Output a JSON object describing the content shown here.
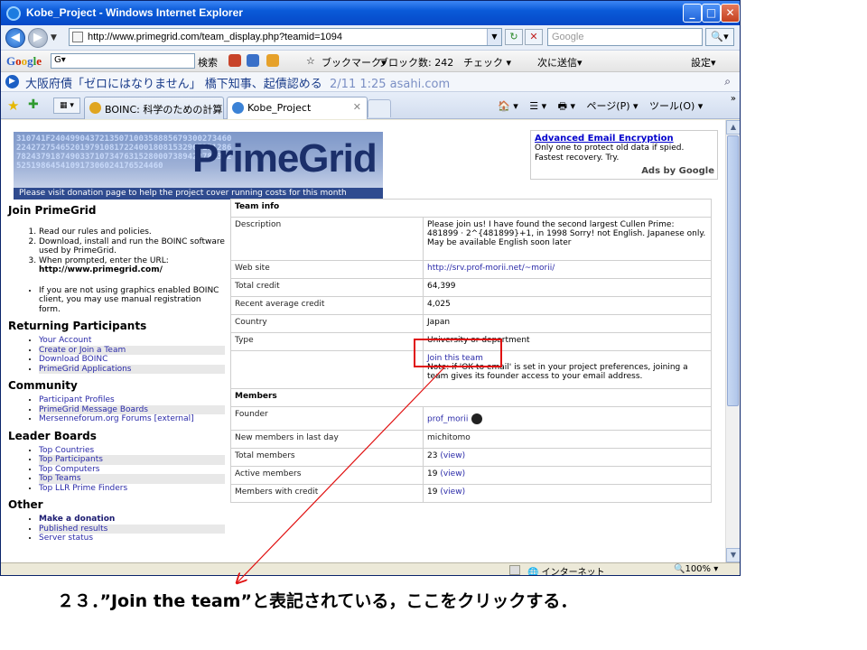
{
  "browser": {
    "window_title": "Kobe_Project - Windows Internet Explorer",
    "minimize": "_",
    "maximize": "□",
    "close": "✕",
    "url": "http://www.primegrid.com/team_display.php?teamid=1094",
    "search_placeholder": "Google",
    "search_button": "🔍▾",
    "google_toolbar": {
      "logo": [
        "G",
        "o",
        "o",
        "g",
        "l",
        "e"
      ],
      "search_label": "検索",
      "bookmarks": "ブックマーク▾",
      "blocked": "ブロック数: 242",
      "check": "チェック ▾",
      "send": "次に送信▾",
      "settings": "設定▾"
    },
    "news": {
      "headline": "大阪府債「ゼロにはなりません」 橋下知事、起債認める",
      "time": "2/11 1:25 asahi.com"
    },
    "tabs": [
      {
        "label": "BOINC: 科学のための計算を..."
      },
      {
        "label": "Kobe_Project",
        "close": "✕"
      }
    ],
    "commands": [
      "🏠 ▾",
      "☰ ▾",
      "🖶 ▾",
      "ページ(P) ▾",
      "ツール(O) ▾"
    ],
    "status": {
      "zone": "インターネット",
      "zoom": "🔍100% ▾"
    }
  },
  "page": {
    "banner": {
      "brand": "PrimeGrid",
      "digits": "310741F24049904372135071003588856793002734602242727546520197910817224001808153296717128678243791874903371073476315280007389422782352525198645410917306024176524460",
      "donate": "Please visit donation page to help the project cover running costs for this month"
    },
    "ad": {
      "title": "Advanced Email Encryption",
      "line1": "Only one to protect old data if spied.",
      "line2": "Fastest recovery. Try.",
      "ads_by": "Ads by Google"
    },
    "sidebar": {
      "join_title": "Join PrimeGrid",
      "join_steps": [
        "Read our rules and policies.",
        "Download, install and run the BOINC software used by PrimeGrid.",
        "When prompted, enter the URL:"
      ],
      "join_url": "http://www.primegrid.com/",
      "note": "If you are not using graphics enabled BOINC client, you may use manual registration form.",
      "returning_title": "Returning Participants",
      "returning_links": [
        "Your Account",
        "Create or Join a Team",
        "Download BOINC",
        "PrimeGrid Applications"
      ],
      "community_title": "Community",
      "community_links": [
        "Participant Profiles",
        "PrimeGrid Message Boards",
        "Mersenneforum.org Forums [external]"
      ],
      "leader_title": "Leader Boards",
      "leader_links": [
        "Top Countries",
        "Top Participants",
        "Top Computers",
        "Top Teams",
        "Top LLR Prime Finders"
      ],
      "other_title": "Other",
      "other_links": [
        "Make a donation",
        "Published results",
        "Server status"
      ]
    },
    "team": {
      "header": "Team info",
      "description_label": "Description",
      "description": "Please join us! I have found the second largest Cullen Prime: 481899 · 2^{481899}+1, in 1998 Sorry! not English. Japanese only. May be available English soon later",
      "website_label": "Web site",
      "website": "http://srv.prof-morii.net/~morii/",
      "total_credit_label": "Total credit",
      "total_credit": "64,399",
      "rac_label": "Recent average credit",
      "rac": "4,025",
      "country_label": "Country",
      "country": "Japan",
      "type_label": "Type",
      "type": "University or department",
      "join_link": "Join this team",
      "join_note": "Note: if 'OK to email' is set in your project preferences, joining a team gives its founder access to your email address.",
      "members_header": "Members",
      "founder_label": "Founder",
      "founder": "prof_morii",
      "new_members_label": "New members in last day",
      "new_members": "michitomo",
      "total_members_label": "Total members",
      "total_members": "23",
      "active_members_label": "Active members",
      "active_members": "19",
      "with_credit_label": "Members with credit",
      "with_credit": "19",
      "view": "(view)"
    }
  },
  "annotation": {
    "caption": "２３．”Join the team”と表記されている，ここをクリックする．",
    "color": "#e01010"
  }
}
